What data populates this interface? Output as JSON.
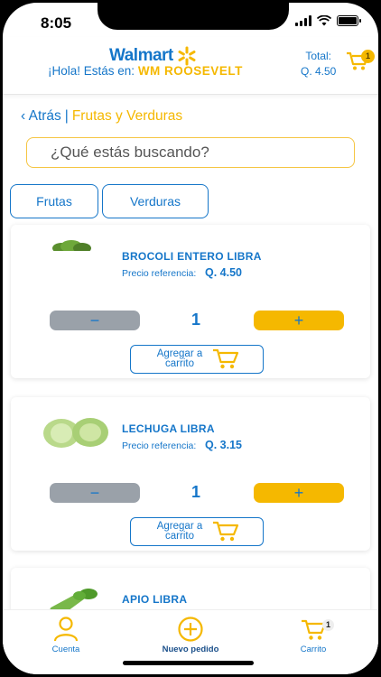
{
  "status_bar": {
    "time": "8:05"
  },
  "header": {
    "brand": "Walmart",
    "greeting_prefix": "¡Hola! Estás en:",
    "store": "WM ROOSEVELT",
    "total_label": "Total:",
    "total_value": "Q. 4.50",
    "cart_count": "1"
  },
  "breadcrumb": {
    "back": "‹ Atrás",
    "separator": "|",
    "category": "Frutas y Verduras"
  },
  "search": {
    "placeholder": "¿Qué estás buscando?"
  },
  "filters": [
    {
      "label": "Frutas"
    },
    {
      "label": "Verduras"
    }
  ],
  "products": [
    {
      "name": "BROCOLI ENTERO LIBRA",
      "price_label": "Precio referencia:",
      "price": "Q. 4.50",
      "quantity": "1",
      "add_label": "Agregar a carrito",
      "image_icon": "broccoli-image"
    },
    {
      "name": "LECHUGA LIBRA",
      "price_label": "Precio referencia:",
      "price": "Q. 3.15",
      "quantity": "1",
      "add_label": "Agregar a carrito",
      "image_icon": "lettuce-image"
    },
    {
      "name": "APIO LIBRA",
      "image_icon": "celery-image"
    }
  ],
  "tabbar": {
    "items": [
      {
        "label": "Cuenta",
        "icon": "user-icon"
      },
      {
        "label": "Nuevo pedido",
        "icon": "plus-circle-icon"
      },
      {
        "label": "Carrito",
        "icon": "cart-icon",
        "badge": "1"
      }
    ]
  },
  "colors": {
    "primary": "#1576c9",
    "accent": "#f5b800",
    "minus_gray": "#9aa1a9"
  }
}
